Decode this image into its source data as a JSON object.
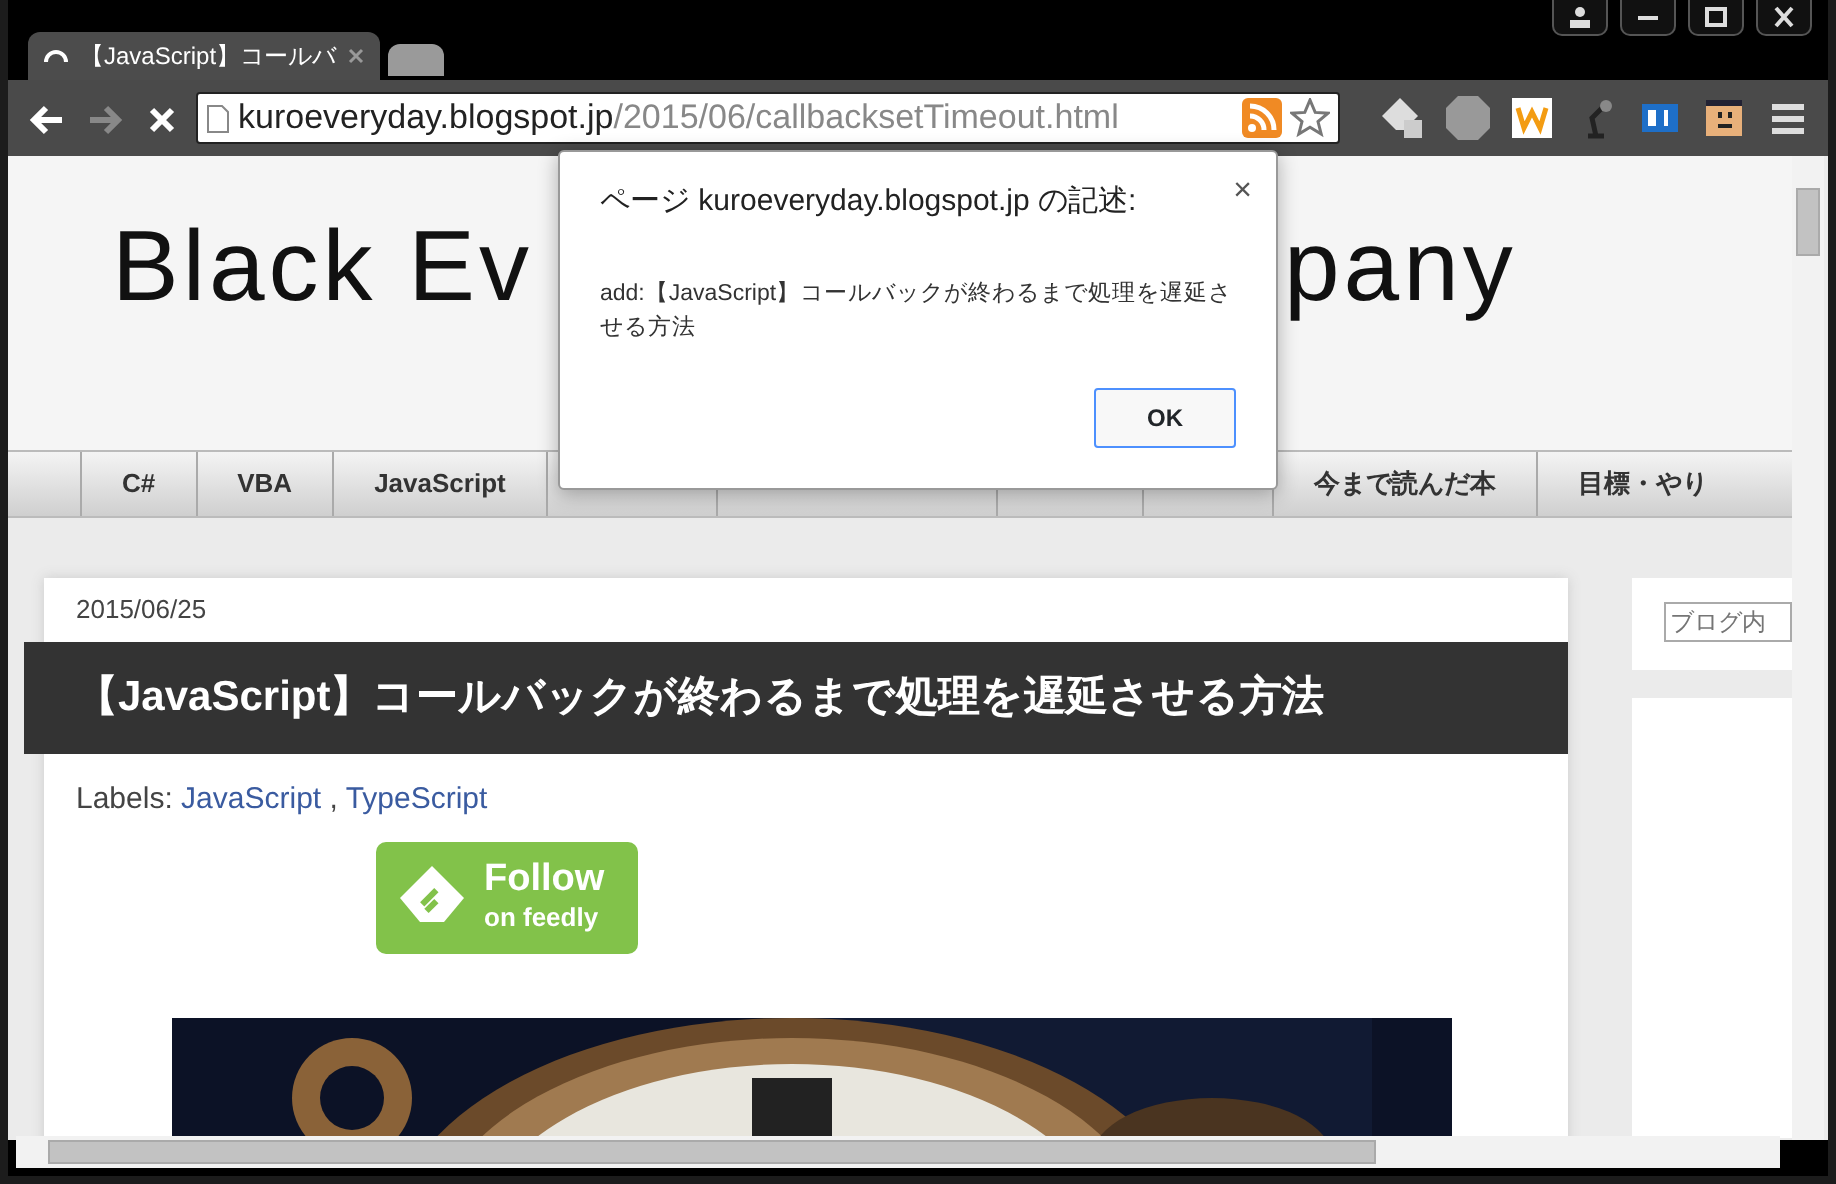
{
  "tabs": [
    {
      "title": "【JavaScript】コールバ",
      "loading": true,
      "selected": true
    },
    {
      "selected": false
    }
  ],
  "toolbar": {
    "url_host": "kuroeveryday.blogspot.jp",
    "url_path": "/2015/06/callbacksetTimeout.html",
    "bookmarked": false
  },
  "blog": {
    "title_left": "Black Ev",
    "title_right": "pany",
    "nav": [
      {
        "label": "C#"
      },
      {
        "label": "VBA"
      },
      {
        "label": "JavaScript"
      },
      {
        "label": "今まで読んだ本"
      },
      {
        "label": "目標・やり"
      }
    ],
    "post": {
      "date": "2015/06/25",
      "title": "【JavaScript】コールバックが終わるまで処理を遅延させる方法",
      "labels_prefix": "Labels:",
      "labels": [
        "JavaScript",
        "TypeScript"
      ],
      "label_separator": ",",
      "follow": {
        "line1": "Follow",
        "line2": "on feedly"
      }
    },
    "sidebar": {
      "search_placeholder": "ブログ内"
    }
  },
  "dialog": {
    "title": "ページ kuroeveryday.blogspot.jp の記述:",
    "close": "×",
    "message": "add:【JavaScript】コールバックが終わるまで処理を遅延させる方法",
    "button": "OK"
  }
}
